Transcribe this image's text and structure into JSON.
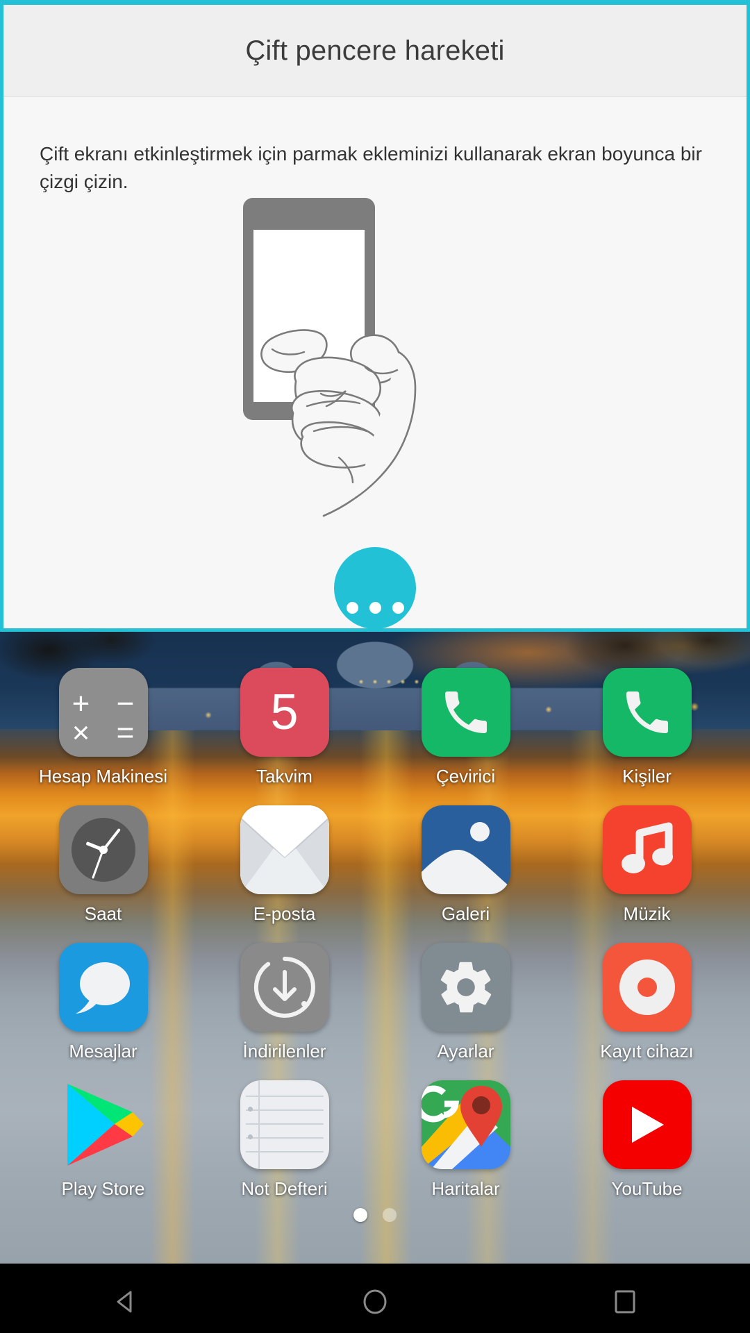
{
  "dialog": {
    "title": "Çift pencere hareketi",
    "description": "Çift ekranı etkinleştirmek için parmak ekleminizi kullanarak ekran boyunca bir çizgi çizin.",
    "accent_color": "#22c1d6",
    "illustration": "knuckle-swipe-on-phone-illustration",
    "more_button": {
      "name": "more-options-button",
      "dots": 3,
      "color": "#22c1d6"
    }
  },
  "home": {
    "apps": [
      {
        "label": "Hesap Makinesi",
        "icon": "calculator-icon",
        "symbols": [
          "+",
          "−",
          "×",
          "="
        ],
        "color": "#8e8e8e"
      },
      {
        "label": "Takvim",
        "icon": "calendar-icon",
        "day": "5",
        "color": "#dc4b5c"
      },
      {
        "label": "Çevirici",
        "icon": "phone-dialer-icon",
        "color": "#14b866"
      },
      {
        "label": "Kişiler",
        "icon": "contacts-phone-icon",
        "color": "#14b866"
      },
      {
        "label": "Saat",
        "icon": "clock-icon",
        "color": "#7d7d7d"
      },
      {
        "label": "E-posta",
        "icon": "email-envelope-icon",
        "color": "#e6e9ec"
      },
      {
        "label": "Galeri",
        "icon": "gallery-photo-icon",
        "color": "#2a5f9e"
      },
      {
        "label": "Müzik",
        "icon": "music-note-icon",
        "color": "#f4422e"
      },
      {
        "label": "Mesajlar",
        "icon": "messages-bubble-icon",
        "color": "#1b9ae0"
      },
      {
        "label": "İndirilenler",
        "icon": "download-arrow-icon",
        "color": "#8a8a8a"
      },
      {
        "label": "Ayarlar",
        "icon": "settings-gear-icon",
        "color": "#808b92"
      },
      {
        "label": "Kayıt cihazı",
        "icon": "sound-recorder-icon",
        "color": "#f4563c"
      },
      {
        "label": "Play Store",
        "icon": "google-play-icon",
        "color": "#00c3f7"
      },
      {
        "label": "Not Defteri",
        "icon": "notepad-icon",
        "color": "#eceef1"
      },
      {
        "label": "Haritalar",
        "icon": "google-maps-icon",
        "color": "#34a853"
      },
      {
        "label": "YouTube",
        "icon": "youtube-play-icon",
        "color": "#f50000"
      }
    ],
    "page_indicator": {
      "total": 2,
      "active": 1
    }
  },
  "navbar": {
    "buttons": [
      {
        "name": "back-button",
        "icon": "triangle-back-icon"
      },
      {
        "name": "home-button",
        "icon": "circle-home-icon"
      },
      {
        "name": "recents-button",
        "icon": "square-recents-icon"
      }
    ]
  }
}
